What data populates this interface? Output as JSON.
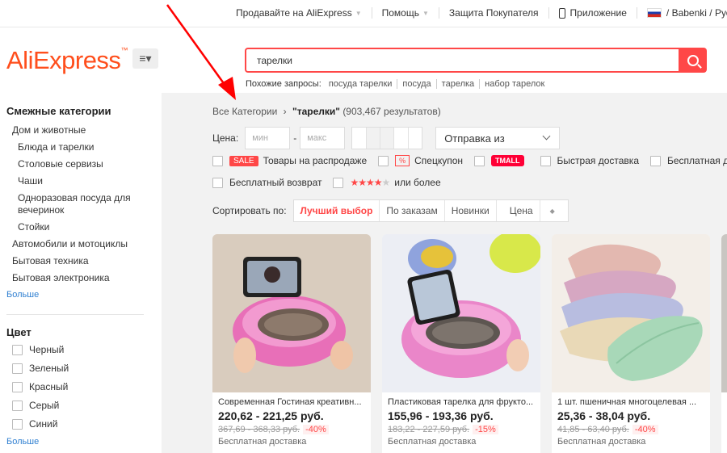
{
  "topnav": {
    "sell": "Продавайте на AliExpress",
    "help": "Помощь",
    "buyer_protection": "Защита Покупателя",
    "app": "Приложение",
    "locale": "/ Babenki / Русский /"
  },
  "logo": {
    "text": "AliExpress",
    "tm": "™"
  },
  "search": {
    "query": "тарелки"
  },
  "related": {
    "label": "Похожие запросы:",
    "queries": [
      "посуда тарелки",
      "посуда",
      "тарелка",
      "набор тарелок"
    ]
  },
  "sidebar": {
    "related_heading": "Смежные категории",
    "categories": [
      {
        "label": "Дом и животные",
        "level": 1
      },
      {
        "label": "Блюда и тарелки",
        "level": 2
      },
      {
        "label": "Столовые сервизы",
        "level": 2
      },
      {
        "label": "Чаши",
        "level": 2
      },
      {
        "label": "Одноразовая посуда для вечеринок",
        "level": 2
      },
      {
        "label": "Стойки",
        "level": 2
      },
      {
        "label": "Автомобили и мотоциклы",
        "level": 1
      },
      {
        "label": "Бытовая техника",
        "level": 1
      },
      {
        "label": "Бытовая электроника",
        "level": 1
      }
    ],
    "more1": "Больше",
    "color_heading": "Цвет",
    "colors": [
      "Черный",
      "Зеленый",
      "Красный",
      "Серый",
      "Синий"
    ],
    "more2": "Больше"
  },
  "breadcrumb": {
    "root": "Все Категории",
    "sep": "›",
    "query": "\"тарелки\"",
    "count": "(903,467 результатов)"
  },
  "price_filter": {
    "label": "Цена:",
    "min_placeholder": "мин",
    "dash": "-",
    "max_placeholder": "макс"
  },
  "ship_from": {
    "label": "Отправка из"
  },
  "filters": {
    "sale_badge": "SALE",
    "sale": "Товары на распродаже",
    "coupon_icon": "%",
    "coupon": "Спецкупон",
    "tmall": "TMALL",
    "fast": "Быстрая доставка",
    "free": "Бесплатная д",
    "free_return": "Бесплатный возврат",
    "stars_on": "★★★★",
    "stars_off": "★",
    "or_more": "или более"
  },
  "sort": {
    "label": "Сортировать по:",
    "options": [
      "Лучший выбор",
      "По заказам",
      "Новинки",
      "Цена"
    ],
    "price_icon": "◆"
  },
  "products": [
    {
      "title": "Современная Гостиная креативн...",
      "price": "220,62 - 221,25 руб.",
      "old_price": "367,69 - 368,33 руб.",
      "discount": "-40%",
      "shipping": "Бесплатная доставка"
    },
    {
      "title": "Пластиковая тарелка для фрукто...",
      "price": "155,96 - 193,36 руб.",
      "old_price": "183,22 - 227,59 руб.",
      "discount": "-15%",
      "shipping": "Бесплатная доставка"
    },
    {
      "title": "1 шт. пшеничная многоцелевая ...",
      "price": "25,36 - 38,04 руб.",
      "old_price": "41,85 - 63,40 руб.",
      "discount": "-40%",
      "shipping": "Бесплатная доставка"
    }
  ],
  "colors": {
    "accent": "#ff4747",
    "logo": "#ff4e1c",
    "link": "#2f7fd1",
    "annotation_arrow": "#ff0000"
  },
  "icons": [
    "menu-icon",
    "search-icon",
    "phone-icon",
    "russia-flag-icon",
    "chevron-down-icon",
    "coupon-icon",
    "sort-icon"
  ]
}
